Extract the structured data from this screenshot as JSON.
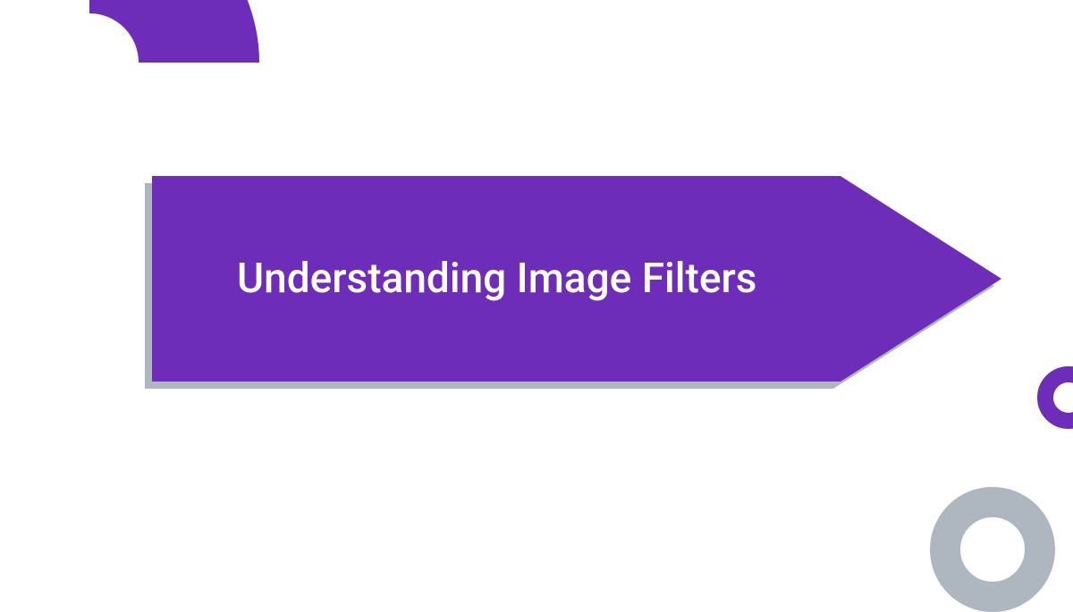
{
  "banner": {
    "title": "Understanding Image Filters"
  },
  "colors": {
    "primary": "#6e2db8",
    "shadow": "#aeb7c0",
    "grayRing": "#aeb7c0"
  }
}
